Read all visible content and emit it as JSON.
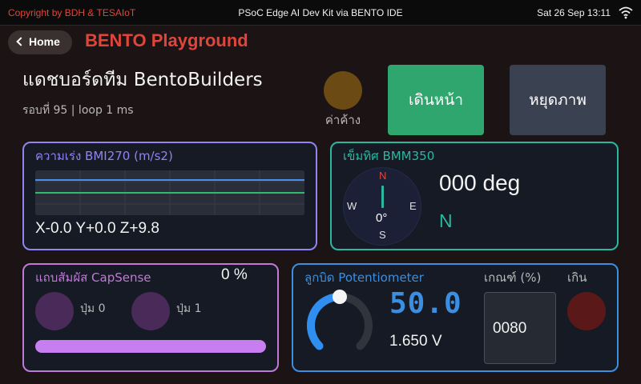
{
  "statusbar": {
    "copyright": "Copyright by BDH & TESAIoT",
    "device": "PSoC Edge AI Dev Kit via BENTO IDE",
    "datetime": "Sat 26 Sep 13:11",
    "wifi_icon": "wifi-icon"
  },
  "header": {
    "home_label": "Home",
    "home_icon": "chevron-left-icon",
    "app_title": "BENTO Playground",
    "title_color": "#e0453a"
  },
  "dashboard": {
    "title": "แดชบอร์ดทีม BentoBuilders",
    "subtitle": "รอบที่ 95 | loop 1 ms",
    "status_label": "ค่าค้าง",
    "status_color": "#6b4a14"
  },
  "actions": {
    "forward_label": "เดินหน้า",
    "pause_label": "หยุดภาพ",
    "forward_color": "#2ea66e",
    "pause_color": "#3a4150"
  },
  "accelerometer": {
    "title": "ความเร่ง BMI270 (m/s2)",
    "reading": "X-0.0 Y+0.0 Z+9.8",
    "color": "#8f84f0"
  },
  "magnetometer": {
    "title": "เข็มทิศ BMM350",
    "compass_n": "N",
    "compass_s": "S",
    "compass_e": "E",
    "compass_w": "W",
    "compass_deg": "0°",
    "heading_text": "000 deg",
    "direction": "N",
    "color": "#2ab8a0"
  },
  "capsense": {
    "title": "แถบสัมผัส CapSense",
    "percent": "0 %",
    "button0_label": "ปุ่ม 0",
    "button1_label": "ปุ่ม 1",
    "slider_value_percent": 0,
    "color": "#c07ad6"
  },
  "potentiometer": {
    "title": "ลูกบิด Potentiometer",
    "value": "50.0",
    "voltage": "1.650 V",
    "threshold_label": "เกณฑ์ (%)",
    "threshold_value": "0080",
    "over_label": "เกิน",
    "knob_fraction": 0.5,
    "color": "#3b8ee0"
  }
}
